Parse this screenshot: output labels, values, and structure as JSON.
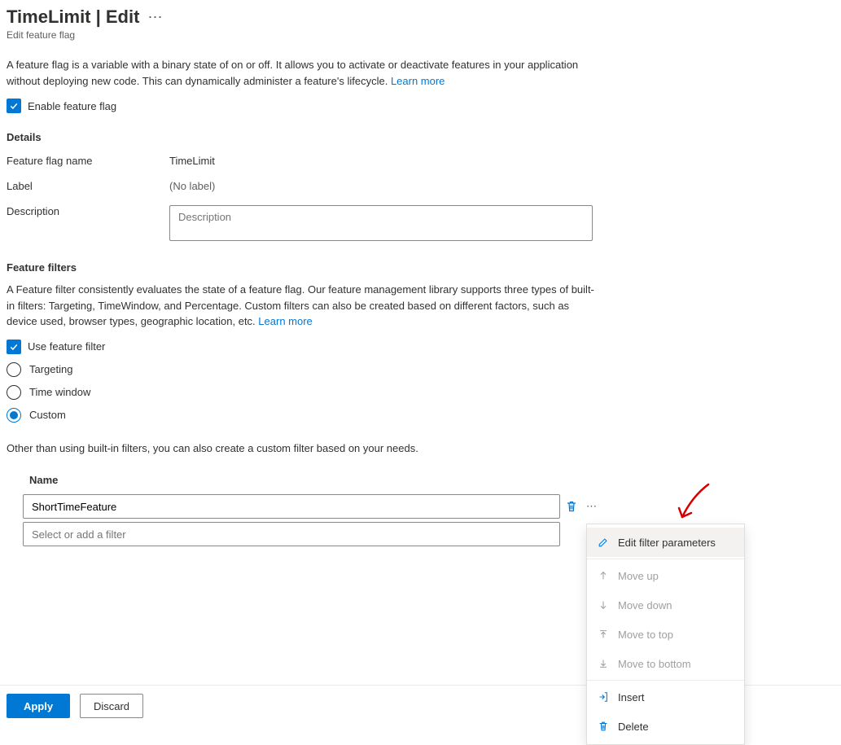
{
  "header": {
    "title": "TimeLimit | Edit",
    "subtitle": "Edit feature flag"
  },
  "intro": {
    "text_a": "A feature flag is a variable with a binary state of on or off. It allows you to activate or deactivate features in your application without deploying new code. This can dynamically administer a feature's lifecycle. ",
    "learn_more": "Learn more"
  },
  "enable_flag": {
    "label": "Enable feature flag",
    "checked": true
  },
  "details": {
    "heading": "Details",
    "name_label": "Feature flag name",
    "name_value": "TimeLimit",
    "label_label": "Label",
    "label_value": "(No label)",
    "description_label": "Description",
    "description_placeholder": "Description",
    "description_value": ""
  },
  "filters": {
    "heading": "Feature filters",
    "intro": "A Feature filter consistently evaluates the state of a feature flag. Our feature management library supports three types of built-in filters: Targeting, TimeWindow, and Percentage. Custom filters can also be created based on different factors, such as device used, browser types, geographic location, etc. ",
    "learn_more": "Learn more",
    "use_filter_label": "Use feature filter",
    "use_filter_checked": true,
    "options": {
      "targeting": "Targeting",
      "time_window": "Time window",
      "custom": "Custom"
    },
    "selected": "custom",
    "custom_desc": "Other than using built-in filters, you can also create a custom filter based on your needs.",
    "table": {
      "name_header": "Name",
      "rows": [
        "ShortTimeFeature"
      ],
      "add_placeholder": "Select or add a filter"
    }
  },
  "footer": {
    "apply": "Apply",
    "discard": "Discard"
  },
  "context_menu": {
    "edit_params": "Edit filter parameters",
    "move_up": "Move up",
    "move_down": "Move down",
    "move_top": "Move to top",
    "move_bottom": "Move to bottom",
    "insert": "Insert",
    "delete": "Delete"
  }
}
